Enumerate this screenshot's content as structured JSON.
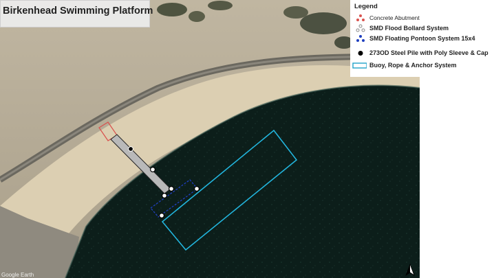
{
  "map": {
    "title": "Birkenhead Swimming Platform",
    "attribution": "Google Earth",
    "north_arrow": "north-arrow-icon"
  },
  "legend": {
    "title": "Legend",
    "items": [
      {
        "label": "Concrete Abutment",
        "symbol": "triangle-dots",
        "color": "#d9534f"
      },
      {
        "label": "SMD Flood Bollard System",
        "symbol": "triangle-dots",
        "color": "#9e9e9e"
      },
      {
        "label": "SMD Floating Pontoon System 15x4",
        "symbol": "triangle-dots",
        "color": "#1f3fbf"
      },
      {
        "label": "273OD Steel Pile with Poly Sleeve & Cap",
        "symbol": "filled-circle",
        "color": "#000000"
      },
      {
        "label": "Buoy, Rope & Anchor System",
        "symbol": "rectangle-outline",
        "color": "#1fa3c9"
      }
    ]
  },
  "colors": {
    "water": "#0d1f1b",
    "sand": "#d9ccb0",
    "land": "#b6ab95",
    "road": "#6d6a63",
    "abutment": "#d9534f",
    "pontoon": "#1f3fbf",
    "buoy_area": "#22b5dd",
    "pile": "#000000"
  }
}
